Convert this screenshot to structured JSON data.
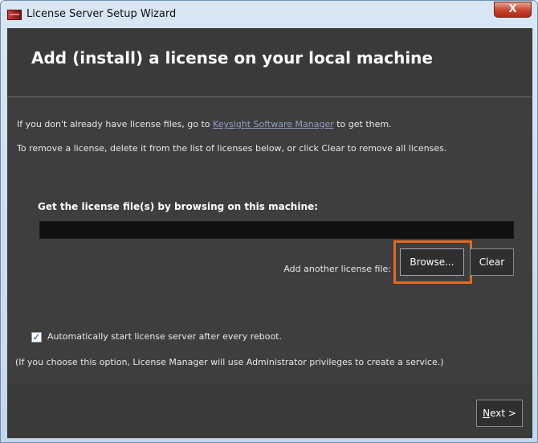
{
  "window": {
    "title": "License Server Setup Wizard",
    "close_symbol": "X"
  },
  "header": {
    "title": "Add (install) a license on your local machine"
  },
  "intro": {
    "line1_prefix": "If you don't already have license files, go to ",
    "line1_link": "Keysight Software Manager",
    "line1_suffix": " to get them.",
    "line2": "To remove a license, delete it from the list of licenses below, or click Clear to remove all licenses."
  },
  "browse_section": {
    "label": "Get the license file(s) by browsing on this machine:",
    "path_value": "",
    "add_label": "Add another license file:",
    "browse_button": "Browse...",
    "clear_button": "Clear",
    "highlight_color": "#e46a1f"
  },
  "options": {
    "auto_start_checked": true,
    "checkmark": "✓",
    "auto_start_label": "Automatically start license server after every reboot.",
    "note": "(If you choose this option, License Manager will use Administrator privileges to create a service.)"
  },
  "footer": {
    "next_mnemonic": "N",
    "next_rest": "ext >"
  },
  "colors": {
    "background": "#3e3e3e",
    "link": "#8ea0c0",
    "highlight": "#e46a1f"
  },
  "icons": {
    "app": "keysight-app-icon",
    "close": "close-icon",
    "checkbox": "checkbox-checked-icon"
  }
}
